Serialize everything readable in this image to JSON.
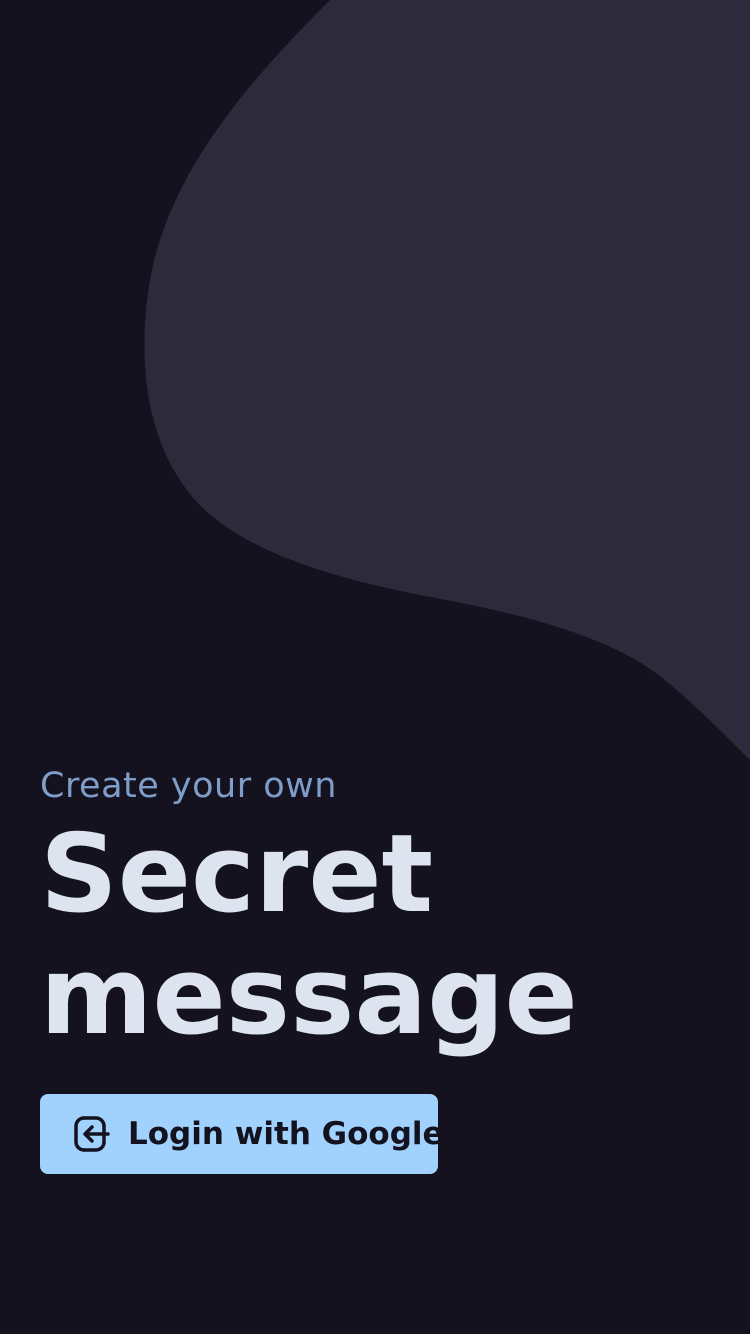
{
  "hero": {
    "tagline": "Create your own",
    "headline_line1": "Secret",
    "headline_line2": "message"
  },
  "login_button": {
    "label": "Login with Google",
    "icon": "login-icon"
  },
  "colors": {
    "background": "#14121f",
    "blob": "#2d2a3b",
    "tagline": "#7f9dc9",
    "headline": "#dde3ef",
    "button_bg": "#a0d2fd",
    "button_text": "#14121f"
  }
}
